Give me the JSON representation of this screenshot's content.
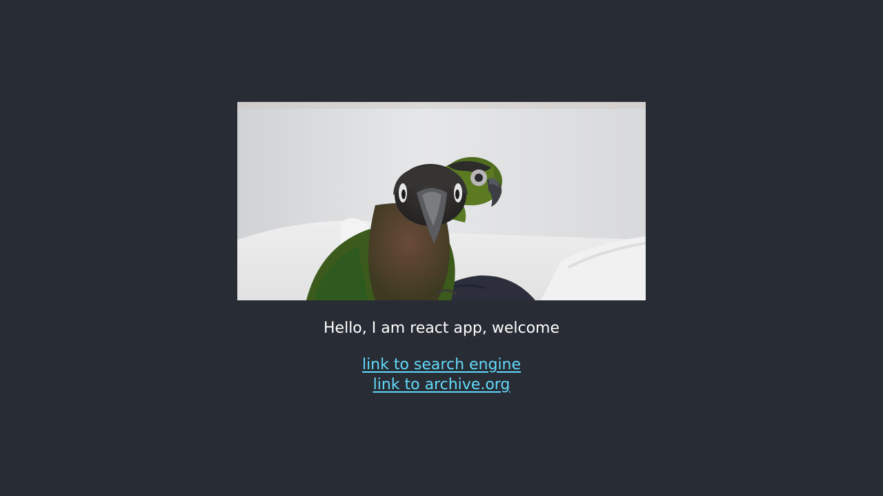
{
  "image": {
    "subject": "two green-cheeked parakeets on a white couch"
  },
  "welcome_text": "Hello, I am react app, welcome",
  "links": [
    {
      "label": "link to search engine"
    },
    {
      "label": "link to archive.org"
    }
  ],
  "colors": {
    "background": "#282c34",
    "text": "#ffffff",
    "link": "#61dafb"
  }
}
